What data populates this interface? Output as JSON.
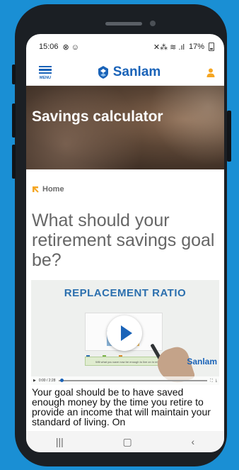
{
  "status": {
    "time": "15:06",
    "left_icons": "⊗ ☺",
    "right_icons": "✕⁂ ≋ .ıl",
    "battery": "17%"
  },
  "nav": {
    "menu_label": "MENU",
    "brand": "Sanlam"
  },
  "hero": {
    "title": "Savings calculator"
  },
  "breadcrumb": {
    "label": "Home"
  },
  "content": {
    "question": "What should your retirement savings goal be?",
    "paragraph": "Your goal should be to have saved enough money by the time you retire to provide an income that will maintain your standard of living. On"
  },
  "video": {
    "title": "REPLACEMENT RATIO",
    "brand": "Sanlam",
    "note": "Will what you save now be enough to live on in retirement?",
    "time": "0:00 / 2:28"
  },
  "colors": {
    "brand_blue": "#1a63b8",
    "accent_orange": "#f5a623",
    "background_blue": "#1a8fd4"
  }
}
